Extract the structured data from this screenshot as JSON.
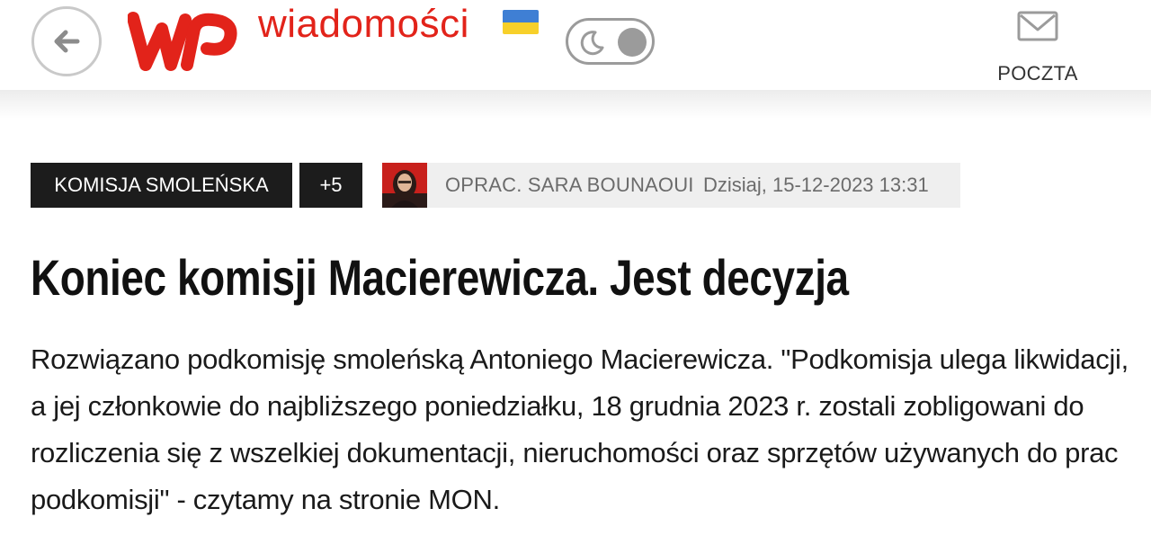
{
  "header": {
    "brand": "wiadomości",
    "mail_label": "POCZTA",
    "dark_mode_enabled": false,
    "flag_colors": {
      "top": "#3f7fd4",
      "bottom": "#f7d02a"
    },
    "accent_color": "#e2231a"
  },
  "article": {
    "tags": [
      "KOMISJA SMOLEŃSKA",
      "+5"
    ],
    "author": "OPRAC. SARA BOUNAOUI",
    "date": "Dzisiaj, 15-12-2023 13:31",
    "title": "Koniec komisji Macierewicza. Jest decyzja",
    "lead": "Rozwiązano podkomisję smoleńską Antoniego Macierewicza. \"Podkomisja ulega likwidacji, a jej członkowie do najbliższego poniedziałku, 18 grudnia 2023 r. zostali zobligowani do rozliczenia się z wszelkiej dokumentacji, nieruchomości oraz sprzętów używanych do prac podkomisji\" - czytamy na stronie MON."
  },
  "icons": {
    "back": "back-arrow-icon",
    "logo": "wp-logo",
    "dark_mode": "moon-icon",
    "mail": "envelope-icon"
  }
}
